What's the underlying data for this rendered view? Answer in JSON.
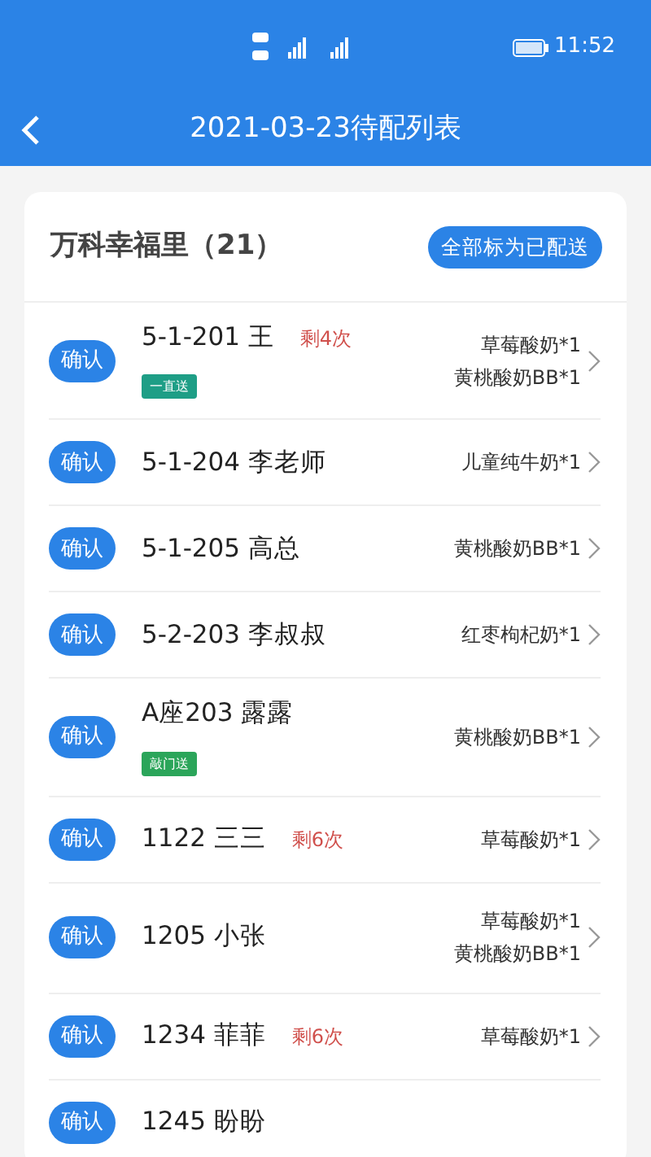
{
  "status_bar": {
    "time": "11:52"
  },
  "header": {
    "title": "2021-03-23待配列表"
  },
  "group": {
    "title": "万科幸福里（21）",
    "action": "全部标为已配送"
  },
  "rows": [
    {
      "button": "确认",
      "name": "5-1-201 王",
      "remaining": "剩4次",
      "tag": {
        "text": "一直送",
        "color": "#1e9e86"
      },
      "items": [
        "草莓酸奶*1",
        "黄桃酸奶BB*1"
      ]
    },
    {
      "button": "确认",
      "name": "5-1-204 李老师",
      "items": [
        "儿童纯牛奶*1"
      ]
    },
    {
      "button": "确认",
      "name": "5-1-205 高总",
      "items": [
        "黄桃酸奶BB*1"
      ]
    },
    {
      "button": "确认",
      "name": "5-2-203 李叔叔",
      "items": [
        "红枣枸杞奶*1"
      ]
    },
    {
      "button": "确认",
      "name": "A座203 露露",
      "tag": {
        "text": "敲门送",
        "color": "#2ba55a"
      },
      "items": [
        "黄桃酸奶BB*1"
      ]
    },
    {
      "button": "确认",
      "name": "1122 三三",
      "remaining": "剩6次",
      "items": [
        "草莓酸奶*1"
      ]
    },
    {
      "button": "确认",
      "name": "1205 小张",
      "items": [
        "草莓酸奶*1",
        "黄桃酸奶BB*1"
      ]
    },
    {
      "button": "确认",
      "name": "1234 菲菲",
      "remaining": "剩6次",
      "items": [
        "草莓酸奶*1"
      ]
    },
    {
      "button": "确认",
      "name": "1245 盼盼"
    }
  ]
}
